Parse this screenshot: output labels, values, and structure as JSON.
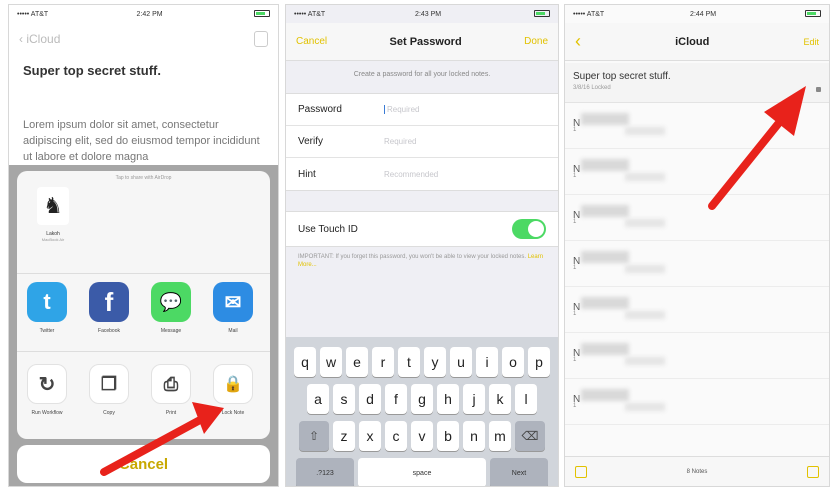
{
  "status": {
    "p1": {
      "carrier": "••••• AT&T",
      "time": "2:42 PM"
    },
    "p2": {
      "carrier": "••••• AT&T",
      "time": "2:43 PM"
    },
    "p3": {
      "carrier": "••••• AT&T",
      "time": "2:44 PM"
    }
  },
  "panel1": {
    "back_label": "iCloud",
    "note_title": "Super top secret stuff.",
    "note_body": "Lorem ipsum dolor sit amet, consectetur adipiscing elit, sed do eiusmod tempor incididunt ut labore et dolore magna",
    "airdrop_hint": "Tap to share with AirDrop",
    "contact": {
      "name": "Lakoh",
      "sub": "MacBook Air"
    },
    "apps": [
      {
        "label": "Twitter",
        "color": "#2fa4e7",
        "glyph": "t"
      },
      {
        "label": "Facebook",
        "color": "#3b5ba8",
        "glyph": "f"
      },
      {
        "label": "Message",
        "color": "#4cd964",
        "glyph": "💬"
      },
      {
        "label": "Mail",
        "color": "#2d8ce3",
        "glyph": "✉"
      }
    ],
    "actions": [
      {
        "label": "Run Workflow",
        "glyph": "↻"
      },
      {
        "label": "Copy",
        "glyph": "❐"
      },
      {
        "label": "Print",
        "glyph": "⎙"
      },
      {
        "label": "Lock Note",
        "glyph": "🔒"
      }
    ],
    "cancel_label": "Cancel"
  },
  "panel2": {
    "cancel_label": "Cancel",
    "title": "Set Password",
    "done_label": "Done",
    "description": "Create a password for all your locked notes.",
    "fields": [
      {
        "label": "Password",
        "placeholder": "Required"
      },
      {
        "label": "Verify",
        "placeholder": "Required"
      },
      {
        "label": "Hint",
        "placeholder": "Recommended"
      }
    ],
    "touch_id_label": "Use Touch ID",
    "touch_id_on": true,
    "note_text": "IMPORTANT: If you forget this password, you won't be able to view your locked notes.",
    "note_link": "Learn More...",
    "keyboard": {
      "row1": [
        "q",
        "w",
        "e",
        "r",
        "t",
        "y",
        "u",
        "i",
        "o",
        "p"
      ],
      "row2": [
        "a",
        "s",
        "d",
        "f",
        "g",
        "h",
        "j",
        "k",
        "l"
      ],
      "row3": [
        "z",
        "x",
        "c",
        "v",
        "b",
        "n",
        "m"
      ],
      "shift": "⇧",
      "delete": "⌫",
      "numbers": ".?123",
      "space": "space",
      "next": "Next"
    }
  },
  "panel3": {
    "back_glyph": "‹",
    "title": "iCloud",
    "edit_label": "Edit",
    "first_note": {
      "title": "Super top secret stuff.",
      "subtitle": "3/8/16   Locked"
    },
    "items": [
      "N",
      "N",
      "N",
      "N",
      "N",
      "N",
      "N"
    ],
    "item_sub": [
      "1",
      "1",
      "1",
      "1",
      "1",
      "1",
      "1"
    ],
    "count_label": "8 Notes"
  },
  "colors": {
    "accent": "#e2c200",
    "arrow": "#e8221b",
    "toggle": "#4cd964"
  }
}
